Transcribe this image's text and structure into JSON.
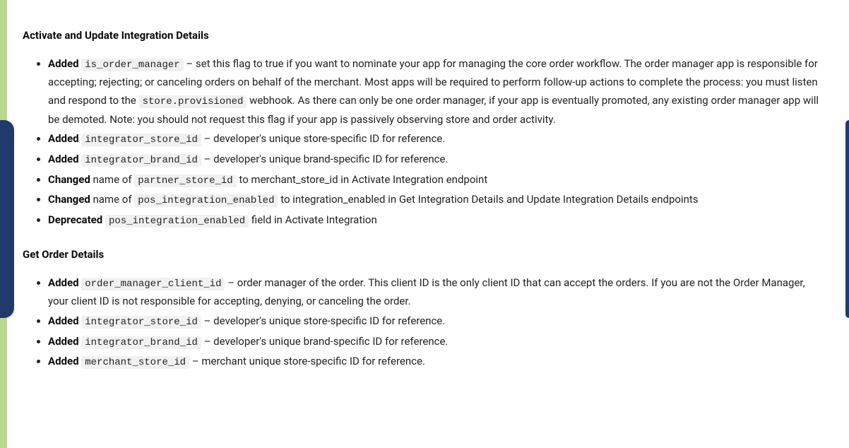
{
  "sections": [
    {
      "title": "Activate and Update Integration Details",
      "items": [
        {
          "tag": "Added",
          "code": "is_order_manager",
          "rest": " – set this flag to true if you want to nominate your app for managing the core order workflow. The order manager app is responsible for accepting; rejecting; or canceling orders on behalf of the merchant. Most apps will be required to perform follow-up actions to complete the process: you must listen and respond to the ",
          "code2": "store.provisioned",
          "rest2": " webhook. As there can only be one order manager, if your app is eventually promoted, any existing order manager app will be demoted. Note: you should not request this flag if your app is passively observing store and order activity."
        },
        {
          "tag": "Added",
          "code": "integrator_store_id",
          "rest": " – developer's unique store-specific ID for reference."
        },
        {
          "tag": "Added",
          "code": "integrator_brand_id",
          "rest": " – developer's unique brand-specific ID for reference."
        },
        {
          "tag": "Changed",
          "pre": " name of ",
          "code": "partner_store_id",
          "rest": " to merchant_store_id in Activate Integration endpoint"
        },
        {
          "tag": "Changed",
          "pre": " name of ",
          "code": "pos_integration_enabled",
          "rest": " to integration_enabled in Get Integration Details and Update Integration Details endpoints"
        },
        {
          "tag": "Deprecated",
          "code": "pos_integration_enabled",
          "rest": " field in Activate Integration"
        }
      ]
    },
    {
      "title": "Get Order Details",
      "items": [
        {
          "tag": "Added",
          "code": "order_manager_client_id",
          "rest": " – order manager of the order. This client ID is the only client ID that can accept the orders. If you are not the Order Manager, your client ID is not responsible for accepting, denying, or canceling the order."
        },
        {
          "tag": "Added",
          "code": "integrator_store_id",
          "rest": " – developer's unique store-specific ID for reference."
        },
        {
          "tag": "Added",
          "code": "integrator_brand_id",
          "rest": " – developer's unique brand-specific ID for reference."
        },
        {
          "tag": "Added",
          "code": "merchant_store_id",
          "rest": " – merchant unique store-specific ID for reference."
        }
      ]
    }
  ]
}
